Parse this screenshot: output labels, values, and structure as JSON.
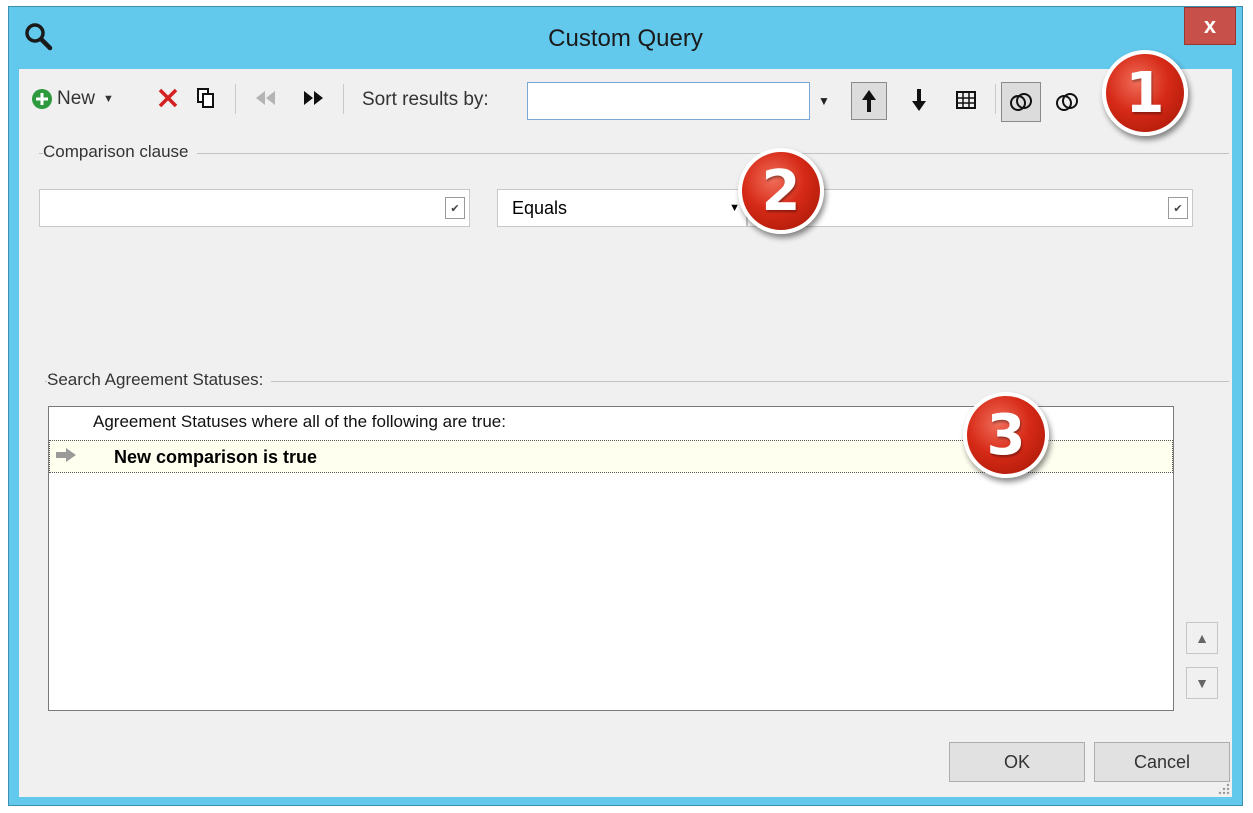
{
  "window": {
    "title": "Custom Query",
    "close_label": "x"
  },
  "toolbar": {
    "new_label": "New",
    "sort_label": "Sort results by:",
    "sort_value": ""
  },
  "comparison": {
    "label": "Comparison clause",
    "field_value": "",
    "operator_value": "Equals",
    "value_value": ""
  },
  "search": {
    "label": "Search Agreement Statuses:",
    "header": "Agreement Statuses where all of the following are true:",
    "rows": [
      {
        "text": "New comparison is true"
      }
    ]
  },
  "buttons": {
    "ok": "OK",
    "cancel": "Cancel"
  },
  "badges": [
    "1",
    "2",
    "3"
  ],
  "colors": {
    "titlebar": "#62c8ec",
    "close": "#c7504a",
    "badge": "#d62a17",
    "new_icon": "#2e9a3e",
    "delete_icon": "#d42020"
  }
}
